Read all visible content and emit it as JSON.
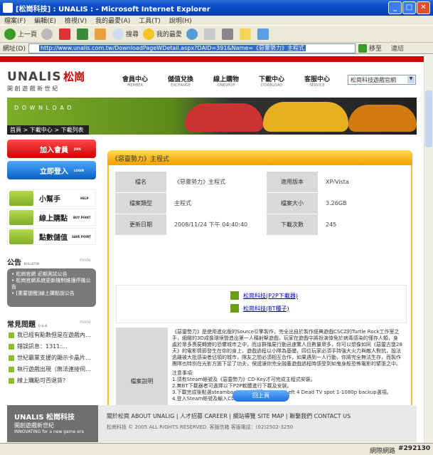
{
  "window": {
    "title": "[松崗科技] : UNALIS : - Microsoft Internet Explorer"
  },
  "menu": [
    "檔案(F)",
    "編輯(E)",
    "檢視(V)",
    "我的最愛(A)",
    "工具(T)",
    "說明(H)"
  ],
  "toolbar": {
    "back": "上一頁",
    "search": "搜尋",
    "favorites": "我的最愛"
  },
  "address": {
    "label": "網址(D)",
    "url": "http://www.unalis.com.tw/DownloadPageWDetail.aspx?DAID=391&Name=《惡靈勢力》主程式",
    "go": "移至",
    "links": "連結"
  },
  "site": {
    "logo_en": "UNALIS",
    "logo_cn": "松崗",
    "slogan": "開 創 遊 戲 新 世 紀",
    "nav": [
      {
        "label": "會員中心",
        "en": "MEMBER"
      },
      {
        "label": "儲值兌換",
        "en": "EXCHANGE"
      },
      {
        "label": "線上購物",
        "en": "ONESHOP"
      },
      {
        "label": "下載中心",
        "en": "DOWNLOAD"
      },
      {
        "label": "客服中心",
        "en": "SERVICE"
      }
    ],
    "site_select": "松崗科技遊戲官網",
    "banner_text": "D O W N L O A D",
    "breadcrumb": "首頁 > 下載中心 > 下載列表"
  },
  "sidebar": {
    "join": "加入會員",
    "join_en": "JOIN",
    "login": "立即登入",
    "login_en": "LOGIN",
    "help": [
      {
        "label": "小幫手",
        "en": "HELP"
      },
      {
        "label": "線上購點",
        "en": "BUY POINT"
      },
      {
        "label": "點數儲值",
        "en": "SAVE POINT"
      }
    ],
    "bulletin_title": "公告",
    "bulletin_en": "BULLETIN",
    "more": "more",
    "bulletins": [
      "松崗官網 近期測試公告",
      "松崗官網系統更新機制維護停機公告",
      "[重要提醒]線上購點說公告"
    ],
    "faq_title": "常見問題",
    "faq_en": "Q & A",
    "faqs": [
      "我已經有點數但是在遊戲內...",
      "錯誤訊息：1311:...",
      "世紀霸業支援的顯示卡晶片...",
      "執行遊戲出現（無法連接伺...",
      "線上購點可否退貨?"
    ]
  },
  "detail": {
    "title": "《惡靈勢力》主程式",
    "rows": [
      [
        "檔名",
        "《惡靈勢力》主程式",
        "適用版本",
        "XP/Vista"
      ],
      [
        "檔案類型",
        "主程式",
        "檔案大小",
        "3.26GB"
      ],
      [
        "更新日期",
        "2008/11/24 下午 04:40:40",
        "下載次數",
        "245"
      ]
    ],
    "download_links": [
      "松崗科技(P2P下載器)",
      "松崗科技(BT種子)"
    ],
    "desc_label": "檔案說明",
    "desc": [
      "《惡靈勢力》是使用進化版的Source引擎製作，完全出自於製作經典遊戲CSCZ的Turtle Rock工作室之手，細緻的3D成像環境營造出第一人稱射擊遊戲，玩家在遊戲中將扮演倖免於病毒感染的僅存人類，身處於眾多喪屍轉變的恐懼城市之中，而這群殭屍行動迅速驚人且數量眾多，你可以想像如同《惡靈古堡28天》的電影情節發生在你的身上，遊戲過程以小隊為基礎，四位玩家必須手持強大火力與敵人對抗，設法逃離被大批感染者佔領的城市，隊友之間必須相互合作，如果遇到一人行動，你將完全無法生存，而製作團隊也特別在光影方面下足了功夫，保證讓你完全融養遊戲過程時感受到如鬼身般恐怖電影的緊張之中。",
      "注意事項:",
      "1.須有Steam帳號及《惡靈勢力》CD-Key才可完成主程式安裝。",
      "2.無BT下載器者可選擇以下P2P軟體進行下載及安裝。",
      "3.下載完成後點選steambackup，並選取Restore Left 4 Dead TV spot 1-1080p backup選項。",
      "4.登入Steam帳號及輸入CD-KEY後即可進行安裝。"
    ]
  },
  "back_button": "回上頁",
  "footer": {
    "logo": "UNALIS 松崗科技",
    "slogan_cn": "開創遊戲新世紀",
    "slogan_en": "INNOVATING for a new game era",
    "links": [
      "關於松崗 ABOUT UNALIG",
      "人才招募 CAREER",
      "網站導覽 SITE MAP",
      "聯繫我們 CONTACT US"
    ],
    "copyright": "松崗科技 © 2005 ALL RIGHTS RESERVED.  客服信箱  客服電話：(02)2502-3250"
  },
  "statusbar": {
    "zone": "網際網路",
    "watermark": "#292130"
  }
}
